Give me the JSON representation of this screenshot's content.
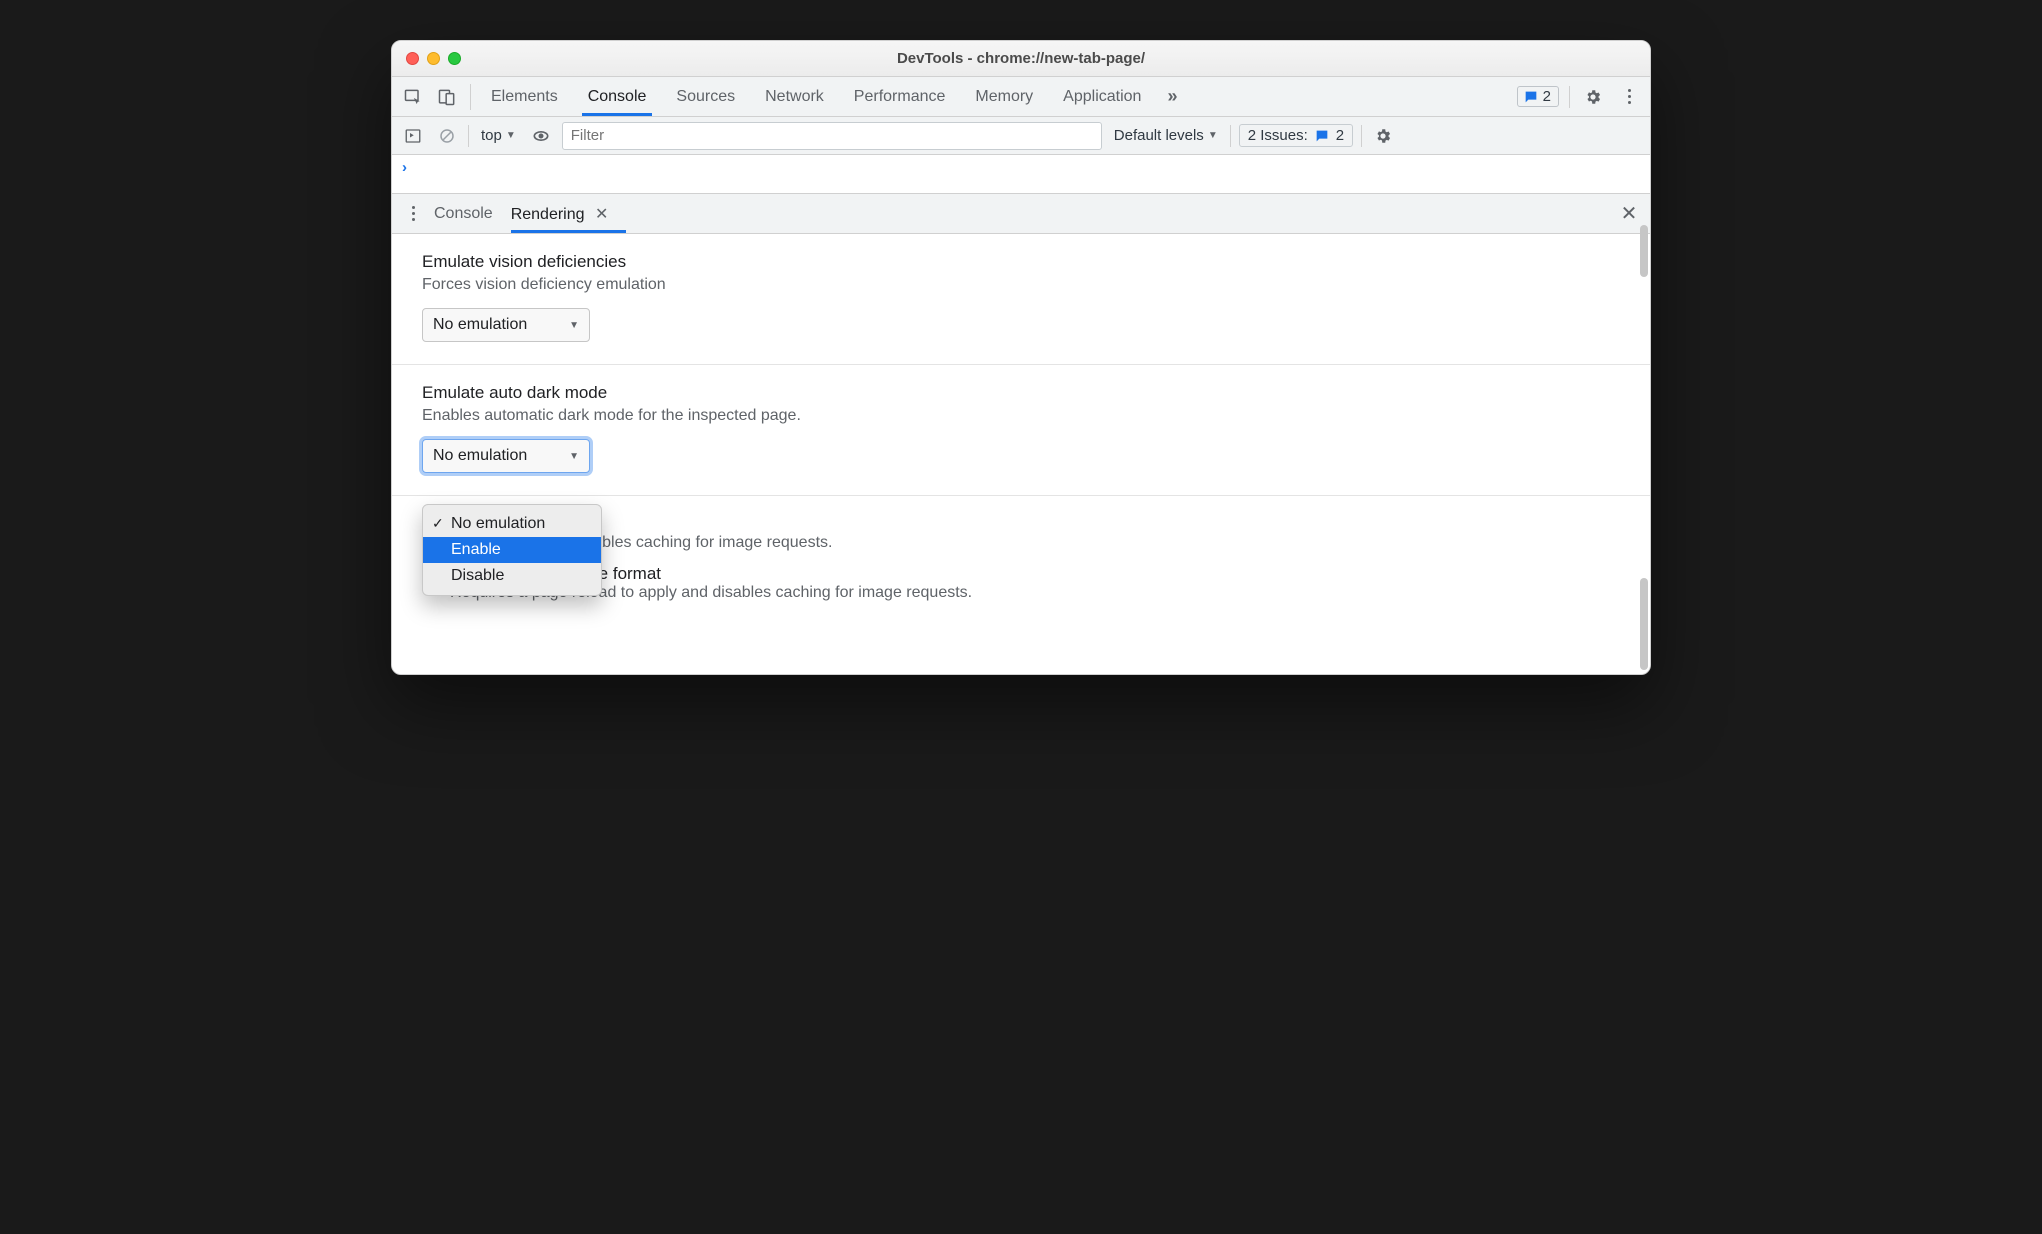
{
  "window": {
    "title": "DevTools - chrome://new-tab-page/"
  },
  "mainTabs": {
    "items": [
      "Elements",
      "Console",
      "Sources",
      "Network",
      "Performance",
      "Memory",
      "Application"
    ],
    "activeIndex": 1,
    "badgeCount": "2"
  },
  "consoleBar": {
    "context": "top",
    "filterPlaceholder": "Filter",
    "levels": "Default levels",
    "issuesLabel": "2 Issues:",
    "issuesCount": "2"
  },
  "drawer": {
    "tabs": [
      "Console",
      "Rendering"
    ],
    "activeIndex": 1
  },
  "rendering": {
    "vision": {
      "title": "Emulate vision deficiencies",
      "desc": "Forces vision deficiency emulation",
      "selected": "No emulation"
    },
    "darkmode": {
      "title": "Emulate auto dark mode",
      "desc": "Enables automatic dark mode for the inspected page.",
      "selected": "No emulation",
      "options": [
        "No emulation",
        "Enable",
        "Disable"
      ],
      "highlightIndex": 1,
      "checkedIndex": 0
    },
    "avif": {
      "title": "format",
      "desc": "oad to apply and disables caching for image requests."
    },
    "webp": {
      "title": "Disable WebP image format",
      "desc": "Requires a page reload to apply and disables caching for image requests."
    }
  }
}
